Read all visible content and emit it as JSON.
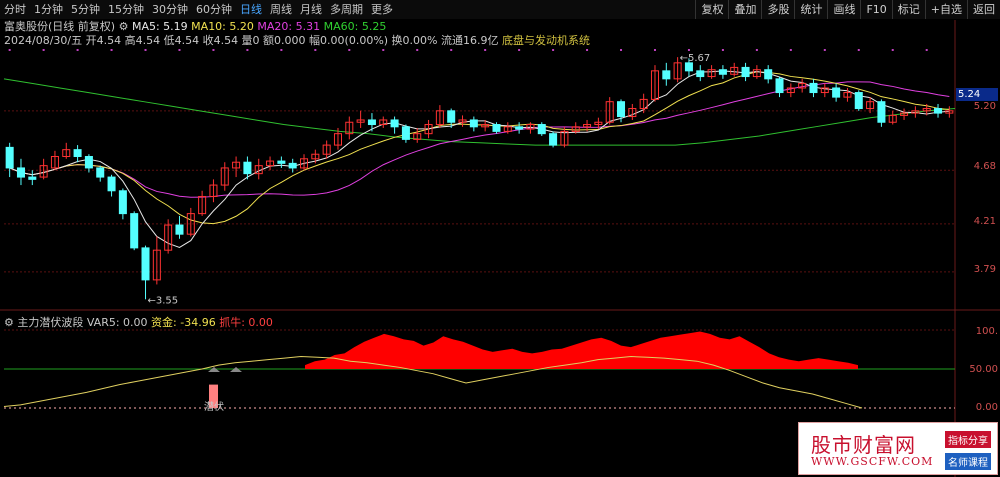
{
  "toolbar": {
    "periods": [
      "分时",
      "1分钟",
      "5分钟",
      "15分钟",
      "30分钟",
      "60分钟",
      "日线",
      "周线",
      "月线",
      "多周期",
      "更多"
    ],
    "active_period": "日线",
    "buttons": [
      "复权",
      "叠加",
      "多股",
      "统计",
      "画线",
      "F10",
      "标记",
      "+自选",
      "返回"
    ]
  },
  "header": {
    "stock": "富奥股份(日线 前复权)",
    "ma5": "MA5: 5.19",
    "ma10": "MA10: 5.20",
    "ma20": "MA20: 5.31",
    "ma60": "MA60: 5.25",
    "quote": "2024/08/30/五 开4.54 高4.54 低4.54 收4.54 量0 额0.000 幅0.00(0.00%) 换0.00% 流通16.9亿",
    "sector": "底盘与发动机系统"
  },
  "price_axis": [
    "5.20",
    "4.68",
    "4.21",
    "3.79"
  ],
  "last_price": "5.24",
  "annotations": {
    "high": "5.67",
    "low": "3.55"
  },
  "sub": {
    "title": "主力潜伏波段",
    "var5": "VAR5: 0.00",
    "fund": "资金: -34.96",
    "bull": "抓牛: 0.00",
    "marker": "潜伏",
    "axis": [
      "100.",
      "50.00",
      "0.00"
    ]
  },
  "watermark": {
    "name": "股市财富网",
    "url": "WWW.GSCFW.COM",
    "badge1": "指标分享",
    "badge2": "名师课程"
  },
  "colors": {
    "up": "#ff3232",
    "down": "#54ffff",
    "ma5": "#e8e8e8",
    "ma10": "#f0e050",
    "ma20": "#e040e0",
    "ma60": "#30c030",
    "fund": "#ff0000"
  },
  "chart_data": {
    "type": "candlestick",
    "ylim": [
      3.5,
      5.75
    ],
    "candles": [
      [
        4.88,
        4.7,
        4.92,
        4.62
      ],
      [
        4.7,
        4.62,
        4.78,
        4.55
      ],
      [
        4.62,
        4.6,
        4.68,
        4.55
      ],
      [
        4.62,
        4.72,
        4.78,
        4.6
      ],
      [
        4.7,
        4.8,
        4.85,
        4.68
      ],
      [
        4.8,
        4.86,
        4.92,
        4.78
      ],
      [
        4.86,
        4.8,
        4.9,
        4.75
      ],
      [
        4.8,
        4.7,
        4.82,
        4.66
      ],
      [
        4.7,
        4.62,
        4.72,
        4.58
      ],
      [
        4.62,
        4.5,
        4.64,
        4.45
      ],
      [
        4.5,
        4.3,
        4.52,
        4.25
      ],
      [
        4.3,
        4.0,
        4.32,
        3.98
      ],
      [
        4.0,
        3.72,
        4.02,
        3.55
      ],
      [
        3.72,
        3.98,
        4.1,
        3.68
      ],
      [
        3.98,
        4.2,
        4.25,
        3.95
      ],
      [
        4.2,
        4.12,
        4.28,
        4.08
      ],
      [
        4.12,
        4.3,
        4.35,
        4.1
      ],
      [
        4.3,
        4.45,
        4.5,
        4.28
      ],
      [
        4.45,
        4.55,
        4.6,
        4.4
      ],
      [
        4.55,
        4.7,
        4.75,
        4.5
      ],
      [
        4.7,
        4.75,
        4.8,
        4.62
      ],
      [
        4.75,
        4.65,
        4.8,
        4.6
      ],
      [
        4.65,
        4.72,
        4.78,
        4.6
      ],
      [
        4.72,
        4.76,
        4.8,
        4.68
      ],
      [
        4.76,
        4.74,
        4.8,
        4.7
      ],
      [
        4.74,
        4.7,
        4.78,
        4.66
      ],
      [
        4.7,
        4.78,
        4.82,
        4.68
      ],
      [
        4.78,
        4.82,
        4.86,
        4.74
      ],
      [
        4.82,
        4.9,
        4.94,
        4.78
      ],
      [
        4.9,
        5.0,
        5.05,
        4.86
      ],
      [
        5.0,
        5.1,
        5.15,
        4.95
      ],
      [
        5.1,
        5.12,
        5.2,
        5.05
      ],
      [
        5.12,
        5.08,
        5.18,
        5.02
      ],
      [
        5.08,
        5.12,
        5.15,
        5.05
      ],
      [
        5.12,
        5.06,
        5.15,
        5.0
      ],
      [
        5.06,
        4.95,
        5.08,
        4.92
      ],
      [
        4.95,
        5.0,
        5.05,
        4.92
      ],
      [
        5.0,
        5.08,
        5.12,
        4.96
      ],
      [
        5.08,
        5.2,
        5.25,
        5.05
      ],
      [
        5.2,
        5.1,
        5.22,
        5.05
      ],
      [
        5.1,
        5.12,
        5.16,
        5.06
      ],
      [
        5.12,
        5.06,
        5.15,
        5.02
      ],
      [
        5.06,
        5.08,
        5.12,
        5.02
      ],
      [
        5.08,
        5.02,
        5.1,
        5.0
      ],
      [
        5.02,
        5.06,
        5.1,
        5.0
      ],
      [
        5.06,
        5.04,
        5.1,
        5.0
      ],
      [
        5.04,
        5.08,
        5.1,
        5.0
      ],
      [
        5.08,
        5.0,
        5.1,
        4.98
      ],
      [
        5.0,
        4.9,
        5.02,
        4.88
      ],
      [
        4.9,
        5.02,
        5.06,
        4.88
      ],
      [
        5.02,
        5.06,
        5.1,
        5.0
      ],
      [
        5.06,
        5.08,
        5.12,
        5.02
      ],
      [
        5.08,
        5.1,
        5.14,
        5.04
      ],
      [
        5.1,
        5.28,
        5.32,
        5.08
      ],
      [
        5.28,
        5.15,
        5.3,
        5.1
      ],
      [
        5.15,
        5.22,
        5.26,
        5.12
      ],
      [
        5.22,
        5.3,
        5.35,
        5.18
      ],
      [
        5.3,
        5.55,
        5.6,
        5.28
      ],
      [
        5.55,
        5.48,
        5.62,
        5.42
      ],
      [
        5.48,
        5.62,
        5.67,
        5.45
      ],
      [
        5.62,
        5.55,
        5.66,
        5.5
      ],
      [
        5.55,
        5.5,
        5.6,
        5.46
      ],
      [
        5.5,
        5.56,
        5.6,
        5.48
      ],
      [
        5.56,
        5.52,
        5.6,
        5.48
      ],
      [
        5.52,
        5.58,
        5.62,
        5.5
      ],
      [
        5.58,
        5.5,
        5.62,
        5.46
      ],
      [
        5.5,
        5.56,
        5.6,
        5.48
      ],
      [
        5.56,
        5.48,
        5.6,
        5.44
      ],
      [
        5.48,
        5.36,
        5.5,
        5.32
      ],
      [
        5.36,
        5.4,
        5.44,
        5.32
      ],
      [
        5.4,
        5.44,
        5.48,
        5.36
      ],
      [
        5.44,
        5.36,
        5.48,
        5.32
      ],
      [
        5.36,
        5.4,
        5.44,
        5.32
      ],
      [
        5.4,
        5.32,
        5.44,
        5.28
      ],
      [
        5.32,
        5.36,
        5.4,
        5.28
      ],
      [
        5.36,
        5.22,
        5.38,
        5.2
      ],
      [
        5.22,
        5.28,
        5.32,
        5.18
      ],
      [
        5.28,
        5.1,
        5.3,
        5.06
      ],
      [
        5.1,
        5.16,
        5.2,
        5.08
      ],
      [
        5.16,
        5.18,
        5.22,
        5.12
      ],
      [
        5.18,
        5.2,
        5.24,
        5.14
      ],
      [
        5.2,
        5.22,
        5.26,
        5.16
      ],
      [
        5.22,
        5.18,
        5.26,
        5.14
      ],
      [
        5.18,
        5.2,
        5.24,
        5.14
      ]
    ],
    "fund": [
      55,
      60,
      62,
      68,
      70,
      78,
      85,
      90,
      95,
      92,
      88,
      86,
      80,
      84,
      92,
      88,
      85,
      80,
      75,
      72,
      74,
      76,
      72,
      70,
      72,
      75,
      76,
      80,
      84,
      88,
      90,
      86,
      80,
      78,
      82,
      86,
      90,
      92,
      94,
      96,
      98,
      95,
      90,
      88,
      92,
      85,
      78,
      70,
      65,
      62,
      60,
      62,
      64,
      62,
      60,
      58,
      55
    ],
    "var5": [
      2,
      4,
      8,
      12,
      16,
      20,
      25,
      30,
      34,
      38,
      42,
      46,
      50,
      55,
      58,
      60,
      62,
      64,
      66,
      65,
      64,
      60,
      58,
      55,
      52,
      48,
      44,
      38,
      32,
      36,
      40,
      44,
      48,
      52,
      55,
      58,
      62,
      64,
      66,
      65,
      64,
      62,
      60,
      55,
      48,
      40,
      32,
      26,
      22,
      18,
      12,
      6,
      0
    ],
    "ma60": [
      5.48,
      5.44,
      5.4,
      5.36,
      5.32,
      5.28,
      5.24,
      5.2,
      5.16,
      5.12,
      5.08,
      5.05,
      5.02,
      5.0,
      4.97,
      4.95,
      4.93,
      4.92,
      4.91,
      4.9,
      4.9,
      4.9,
      4.9,
      4.9,
      4.9,
      4.92,
      4.95,
      4.98,
      5.02,
      5.06,
      5.1,
      5.14,
      5.17,
      5.2,
      5.22
    ]
  }
}
